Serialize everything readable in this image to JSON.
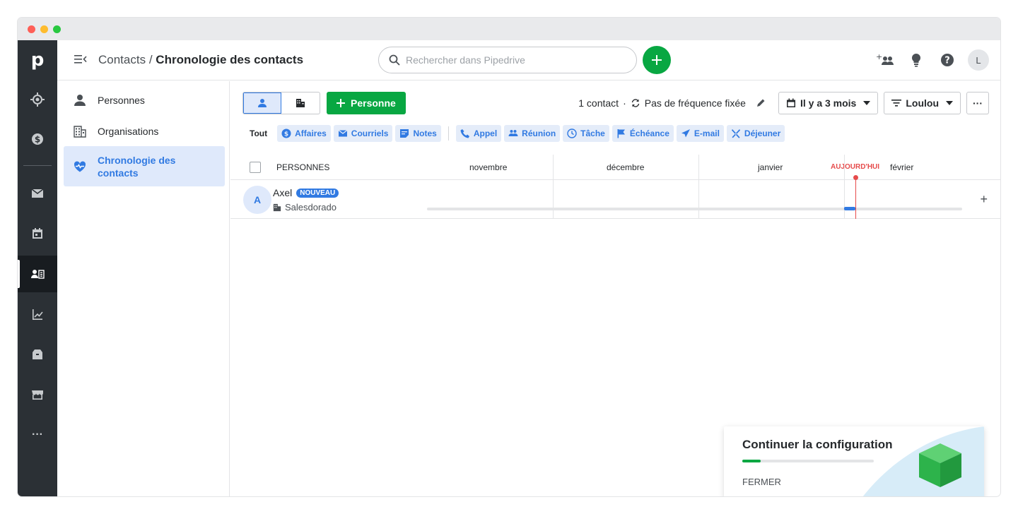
{
  "window": {
    "traffic_lights": [
      "close",
      "minimize",
      "zoom"
    ]
  },
  "rail": {
    "logo": "p",
    "items": [
      {
        "name": "target-icon"
      },
      {
        "name": "dollar-icon"
      },
      {
        "name": "mail-icon"
      },
      {
        "name": "calendar-icon"
      },
      {
        "name": "contacts-icon"
      },
      {
        "name": "chart-icon"
      },
      {
        "name": "box-icon"
      },
      {
        "name": "store-icon"
      },
      {
        "name": "more-icon",
        "label": "···"
      }
    ]
  },
  "header": {
    "breadcrumb_root": "Contacts",
    "breadcrumb_sep": "/",
    "breadcrumb_current": "Chronologie des contacts",
    "search_placeholder": "Rechercher dans Pipedrive",
    "avatar_initial": "L"
  },
  "sidenav": {
    "items": [
      {
        "label": "Personnes"
      },
      {
        "label": "Organisations"
      },
      {
        "label": "Chronologie des contacts"
      }
    ]
  },
  "toolbar": {
    "add_person": "Personne",
    "contact_count": "1 contact",
    "separator": "·",
    "frequency": "Pas de fréquence fixée",
    "period": "Il y a 3 mois",
    "filter": "Loulou",
    "more": "···"
  },
  "filters": {
    "all": "Tout",
    "group1": [
      "Affaires",
      "Courriels",
      "Notes"
    ],
    "group2": [
      "Appel",
      "Réunion",
      "Tâche",
      "Échéance",
      "E-mail",
      "Déjeuner"
    ]
  },
  "table": {
    "header_persons": "PERSONNES",
    "months": [
      "novembre",
      "décembre",
      "janvier",
      "février"
    ],
    "today_label": "AUJOURD'HUI",
    "rows": [
      {
        "initial": "A",
        "name": "Axel",
        "badge": "NOUVEAU",
        "org": "Salesdorado",
        "add": "+"
      }
    ]
  },
  "setup_card": {
    "title": "Continuer la configuration",
    "progress": 0.14,
    "close": "FERMER"
  },
  "colors": {
    "accent": "#317ae2",
    "green": "#08a742",
    "rail": "#2b3035",
    "today": "#e64b4b"
  }
}
